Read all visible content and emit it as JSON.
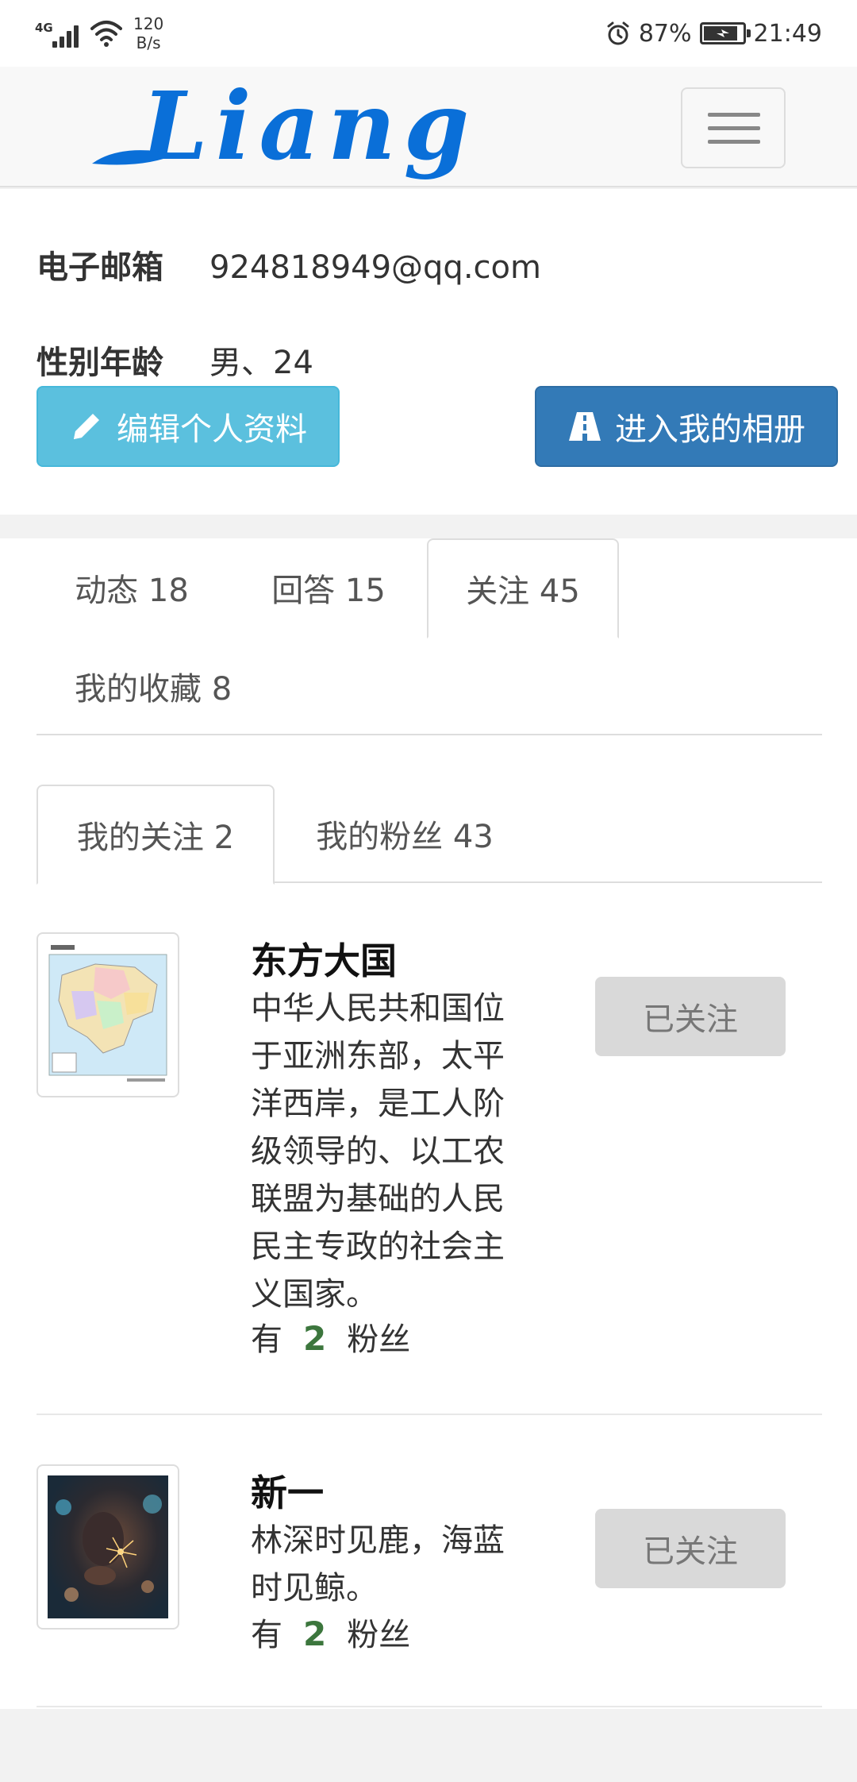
{
  "status_bar": {
    "network": "4G",
    "speed_value": "120",
    "speed_unit": "B/s",
    "battery": "87%",
    "battery_level": 0.87,
    "time": "21:49"
  },
  "navbar": {
    "logo_text": "Liang",
    "logo_color": "#0a6fd8"
  },
  "profile": {
    "email_label": "电子邮箱",
    "email_value": "924818949@qq.com",
    "gender_age_label": "性别年龄",
    "gender_age_value": "男、24",
    "edit_button": "编辑个人资料",
    "album_button": "进入我的相册"
  },
  "tabs": [
    {
      "label": "动态 18",
      "active": false
    },
    {
      "label": "回答 15",
      "active": false
    },
    {
      "label": "关注 45",
      "active": true
    },
    {
      "label": "我的收藏 8",
      "active": false
    }
  ],
  "subtabs": [
    {
      "label": "我的关注 2",
      "active": true
    },
    {
      "label": "我的粉丝 43",
      "active": false
    }
  ],
  "users": [
    {
      "name": "东方大国",
      "description": "中华人民共和国位于亚洲东部，太平洋西岸，是工人阶级领导的、以工农联盟为基础的人民民主专政的社会主义国家。",
      "fans_prefix": "有",
      "fans_count": "2",
      "fans_suffix": "粉丝",
      "button": "已关注",
      "avatar": "map-image"
    },
    {
      "name": "新一",
      "description": "林深时见鹿，海蓝时见鲸。",
      "fans_prefix": "有",
      "fans_count": "2",
      "fans_suffix": "粉丝",
      "button": "已关注",
      "avatar": "sparkler-photo"
    }
  ]
}
